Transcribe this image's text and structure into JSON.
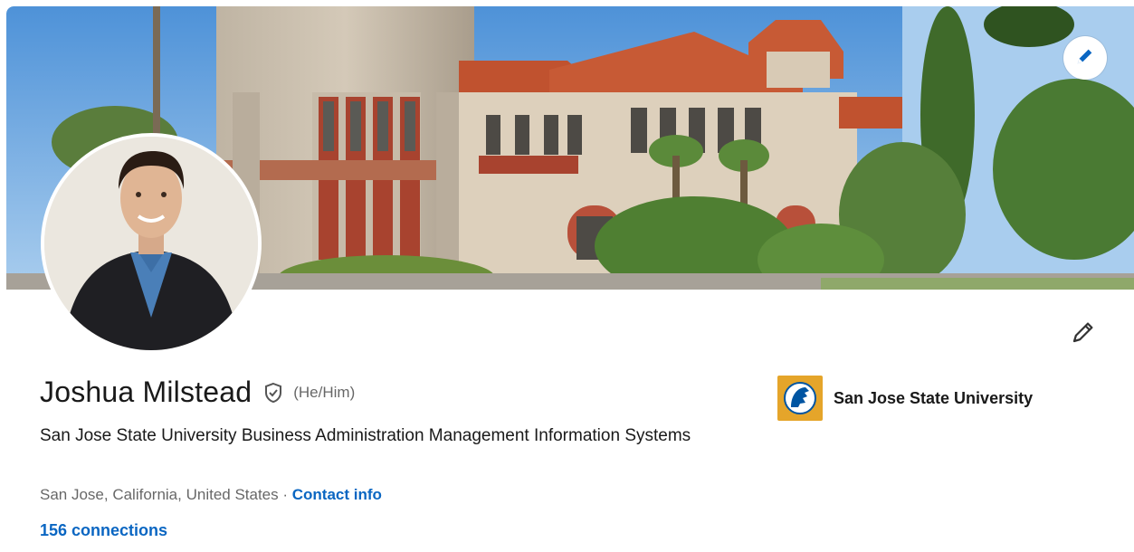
{
  "profile": {
    "name": "Joshua Milstead",
    "pronouns": "(He/Him)",
    "headline": "San Jose State University Business Administration Management Information Systems",
    "location": "San Jose, California, United States",
    "separator": " · ",
    "contact_label": "Contact info",
    "connections": "156 connections"
  },
  "education": {
    "school_name": "San Jose State University"
  },
  "icons": {
    "edit_cover": "pencil-icon",
    "edit_intro": "pencil-icon",
    "verification": "shield-check-icon",
    "school_logo": "spartan-logo"
  },
  "colors": {
    "link": "#0a66c2",
    "sky": "#6aa8e0",
    "school_logo_bg": "#e5a52a"
  }
}
